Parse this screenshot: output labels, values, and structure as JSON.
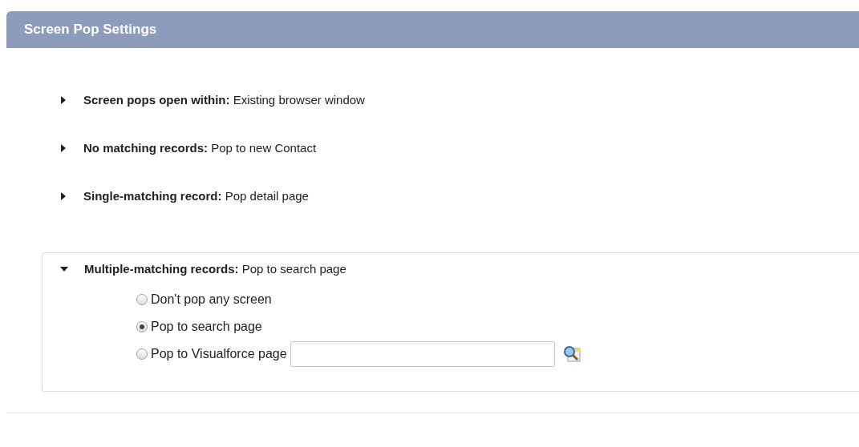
{
  "header": {
    "title": "Screen Pop Settings"
  },
  "settings": [
    {
      "label": "Screen pops open within:",
      "value": "Existing browser window",
      "expanded": false
    },
    {
      "label": "No matching records:",
      "value": "Pop to new Contact",
      "expanded": false
    },
    {
      "label": "Single-matching record:",
      "value": "Pop detail page",
      "expanded": false
    },
    {
      "label": "Multiple-matching records:",
      "value": "Pop to search page",
      "expanded": true,
      "options": [
        {
          "label": "Don't pop any screen",
          "selected": false,
          "kind": "plain"
        },
        {
          "label": "Pop to search page",
          "selected": true,
          "kind": "plain"
        },
        {
          "label": "Pop to Visualforce page",
          "selected": false,
          "kind": "lookup"
        }
      ]
    }
  ]
}
